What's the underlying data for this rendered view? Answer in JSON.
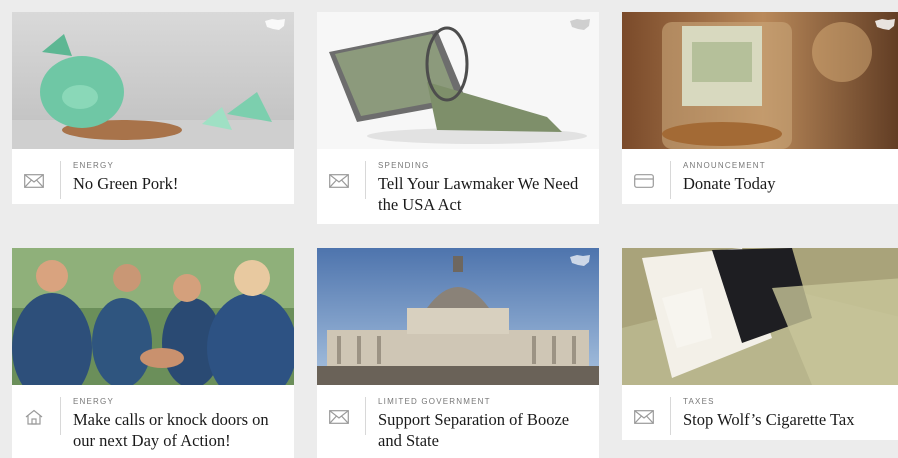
{
  "cards": [
    {
      "category": "ENERGY",
      "title": "No Green Pork!",
      "icon": "envelope-icon"
    },
    {
      "category": "SPENDING",
      "title": "Tell Your Lawmaker We Need the USA Act",
      "icon": "envelope-icon"
    },
    {
      "category": "ANNOUNCEMENT",
      "title": "Donate Today",
      "icon": "credit-card-icon"
    },
    {
      "category": "ENERGY",
      "title": "Make calls or knock doors on our next Day of Action!",
      "icon": "home-icon"
    },
    {
      "category": "LIMITED GOVERNMENT",
      "title": "Support Separation of Booze and State",
      "icon": "envelope-icon"
    },
    {
      "category": "TAXES",
      "title": "Stop Wolf’s Cigarette Tax",
      "icon": "envelope-icon"
    }
  ],
  "colors": {
    "background": "#ececec",
    "card": "#ffffff",
    "text": "#1a1a1a",
    "category": "#777777"
  }
}
